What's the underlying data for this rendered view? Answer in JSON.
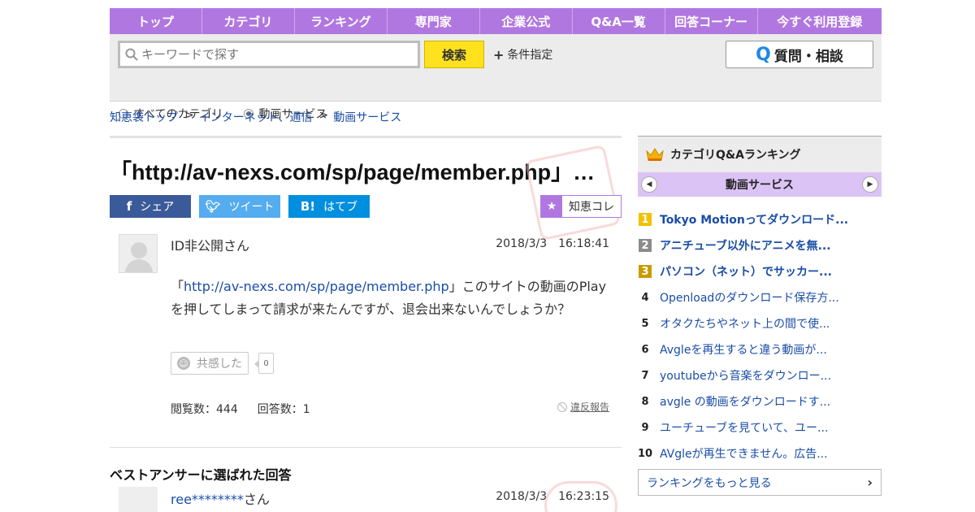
{
  "nav": [
    "トップ",
    "カテゴリ",
    "ランキング",
    "専門家",
    "企業公式",
    "Q&A一覧",
    "回答コーナー",
    "今すぐ利用登録"
  ],
  "search": {
    "placeholder": "キーワードで探す",
    "button": "検索",
    "condition": "条件指定",
    "ask_button": "質問・相談",
    "radio_all": "すべてのカテゴリ",
    "radio_current": "動画サービス"
  },
  "breadcrumb": [
    "知恵袋トップ",
    "インターネット、通信",
    "動画サービス"
  ],
  "question": {
    "title": "「http://av-nexs.com/sp/page/member.php」…",
    "share": {
      "facebook": "シェア",
      "twitter": "ツイート",
      "hatena": "はてブ"
    },
    "chiecolle": "知恵コレ",
    "user": "ID非公開さん",
    "date": "2018/3/3　16:18:41",
    "body_prefix": "「",
    "body_link": "http://av-nexs.com/sp/page/member.php",
    "body_text": "」このサイトの動画のPlayを押してしまって請求が来たんですが、退会出来ないんでしょうか？",
    "sympathy_label": "共感した",
    "sympathy_count": "0",
    "views": "閲覧数：444",
    "answers": "回答数：1",
    "report": "違反報告"
  },
  "best_answer": {
    "heading": "ベストアンサーに選ばれた回答",
    "user_link": "ree********",
    "user_suffix": "さん",
    "date": "2018/3/3　16:23:15"
  },
  "sidebar": {
    "heading": "カテゴリQ&Aランキング",
    "category": "動画サービス",
    "ranking": [
      {
        "num": "1",
        "title": "Tokyo Motionってダウンロード..."
      },
      {
        "num": "2",
        "title": "アニチューブ以外にアニメを無..."
      },
      {
        "num": "3",
        "title": "パソコン（ネット）でサッカー..."
      },
      {
        "num": "4",
        "title": "Openloadのダウンロード保存方..."
      },
      {
        "num": "5",
        "title": "オタクたちやネット上の間で使..."
      },
      {
        "num": "6",
        "title": "Avgleを再生すると違う動画が..."
      },
      {
        "num": "7",
        "title": "youtubeから音楽をダウンロー..."
      },
      {
        "num": "8",
        "title": "avgle の動画をダウンロードす..."
      },
      {
        "num": "9",
        "title": "ユーチューブを見ていて、ユー..."
      },
      {
        "num": "10",
        "title": "AVgleが再生できません。広告..."
      }
    ],
    "more": "ランキングをもっと見る"
  }
}
